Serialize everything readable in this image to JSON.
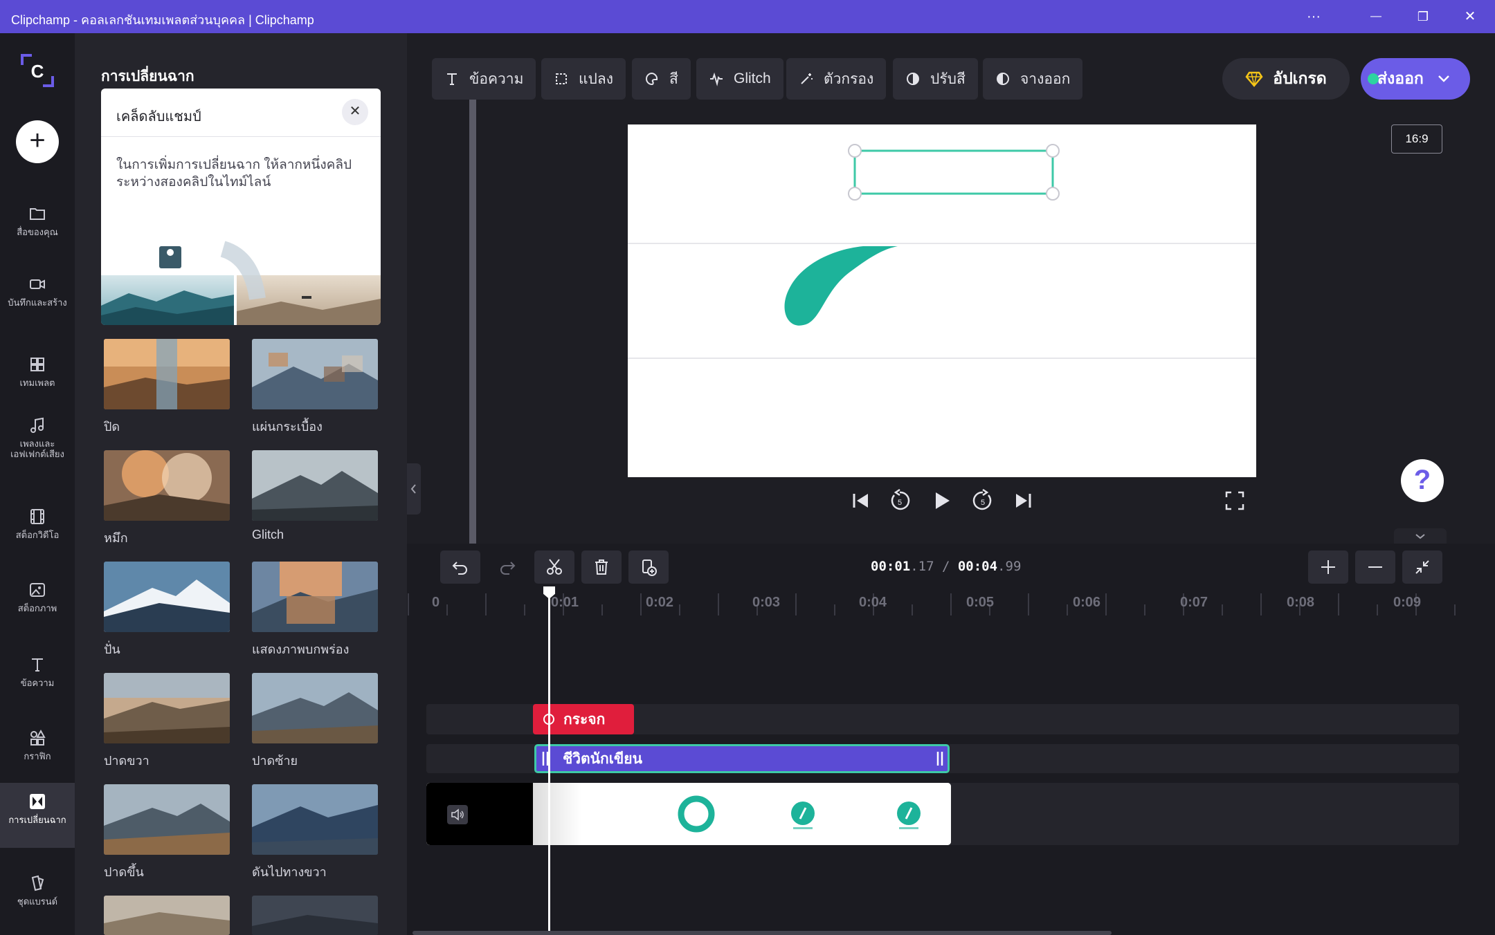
{
  "window": {
    "title": "Clipchamp - คอลเลกชันเทมเพลตส่วนบุคคล | Clipchamp",
    "more_glyph": "···",
    "minimize_glyph": "—",
    "maximize_glyph": "❐",
    "close_glyph": "✕"
  },
  "leftnav": {
    "add_glyph": "+",
    "items": [
      {
        "label": "สื่อของคุณ",
        "icon": "folder-icon"
      },
      {
        "label": "บันทึกและสร้าง",
        "icon": "camera-icon"
      },
      {
        "label": "เทมเพลต",
        "icon": "template-icon"
      },
      {
        "label": "เพลงและเอฟเฟกต์เสียง",
        "icon": "music-icon"
      },
      {
        "label": "สต็อกวิดีโอ",
        "icon": "film-icon"
      },
      {
        "label": "สต็อกภาพ",
        "icon": "image-icon"
      },
      {
        "label": "ข้อความ",
        "icon": "text-icon"
      },
      {
        "label": "กราฟิก",
        "icon": "shapes-icon"
      },
      {
        "label": "การเปลี่ยนฉาก",
        "icon": "transition-icon",
        "active": true
      },
      {
        "label": "ชุดแบรนด์",
        "icon": "brand-kit-icon"
      }
    ]
  },
  "panel": {
    "title": "การเปลี่ยนฉาก",
    "tip": {
      "title": "เคล็ดลับแชมป์",
      "close_glyph": "✕",
      "body": "ในการเพิ่มการเปลี่ยนฉาก ให้ลากหนึ่งคลิประหว่างสองคลิปในไทม์ไลน์"
    },
    "transitions": [
      "ปิด",
      "แผ่นกระเบื้อง",
      "หมึก",
      "Glitch",
      "ปั่น",
      "แสดงภาพบกพร่อง",
      "ปาดขวา",
      "ปาดซ้าย",
      "ปาดขึ้น",
      "ดันไปทางขวา"
    ]
  },
  "toolbar": {
    "text": "ข้อความ",
    "transform": "แปลง",
    "color": "สี",
    "glitch": "Glitch",
    "filter": "ตัวกรอง",
    "adjust": "ปรับสี",
    "fade": "จางออก",
    "upgrade": "อัปเกรด",
    "export": "ส่งออก"
  },
  "preview": {
    "aspect_ratio": "16:9",
    "help_glyph": "?"
  },
  "timeline": {
    "time_current_main": "00:01",
    "time_current_frac": ".17",
    "separator": " / ",
    "time_total_main": "00:04",
    "time_total_frac": ".99",
    "ruler": [
      "0",
      "0:01",
      "0:02",
      "0:03",
      "0:04",
      "0:05",
      "0:06",
      "0:07",
      "0:08",
      "0:09"
    ],
    "clips": {
      "transition": "กระจก",
      "text": "ชีวิตนักเขียน"
    }
  },
  "colors": {
    "accent": "#6b5ce7",
    "titlebar": "#5b4bd4",
    "teal": "#1db39a",
    "red_clip": "#e01e3c"
  }
}
